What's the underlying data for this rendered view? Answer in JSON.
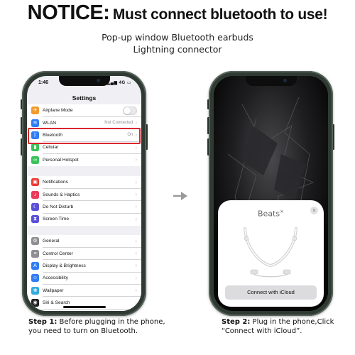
{
  "headline": {
    "notice": "NOTICE:",
    "rest": "Must connect bluetooth to use!"
  },
  "subtitle": {
    "line1": "Pop-up window Bluetooth earbuds",
    "line2": "Lightning connector"
  },
  "left_phone": {
    "time": "1:46",
    "network": "4G",
    "nav_title": "Settings",
    "groups": [
      [
        {
          "label": "Airplane Mode",
          "icon": "airplane-icon",
          "color": "#f29a2e",
          "control": "toggle"
        },
        {
          "label": "WLAN",
          "icon": "wifi-icon",
          "color": "#2f7cf6",
          "value": "Not Connected"
        },
        {
          "label": "Bluetooth",
          "icon": "bluetooth-icon",
          "color": "#2f7cf6",
          "value": "On"
        },
        {
          "label": "Cellular",
          "icon": "cellular-icon",
          "color": "#3ac25b"
        },
        {
          "label": "Personal Hotspot",
          "icon": "hotspot-icon",
          "color": "#3ac25b"
        }
      ],
      [
        {
          "label": "Notifications",
          "icon": "notifications-icon",
          "color": "#ec3b34"
        },
        {
          "label": "Sounds & Haptics",
          "icon": "sound-icon",
          "color": "#ec3b5a"
        },
        {
          "label": "Do Not Disturb",
          "icon": "moon-icon",
          "color": "#5a4fd6"
        },
        {
          "label": "Screen Time",
          "icon": "hourglass-icon",
          "color": "#5a4fd6"
        }
      ],
      [
        {
          "label": "General",
          "icon": "gear-icon",
          "color": "#8e8e93"
        },
        {
          "label": "Control Center",
          "icon": "control-center-icon",
          "color": "#8e8e93"
        },
        {
          "label": "Display & Brightness",
          "icon": "display-icon",
          "color": "#2f7cf6"
        },
        {
          "label": "Accessibility",
          "icon": "accessibility-icon",
          "color": "#2f7cf6"
        },
        {
          "label": "Wallpaper",
          "icon": "wallpaper-icon",
          "color": "#35aadc"
        },
        {
          "label": "Siri & Search",
          "icon": "siri-icon",
          "color": "#222222"
        },
        {
          "label": "Face ID & Passcode",
          "icon": "faceid-icon",
          "color": "#3ac25b"
        }
      ]
    ]
  },
  "right_phone": {
    "popup_title": "Beats",
    "close_symbol": "×",
    "button_label": "Connect with iCloud"
  },
  "steps": {
    "step1_label": "Step 1:",
    "step1_text": " Before plugging in the phone, you need to turn on Bluetooth.",
    "step2_label": "Step 2:",
    "step2_text": " Plug in the phone,Click “Connect with iCloud”."
  },
  "colors": {
    "highlight": "#d9282f",
    "frame": "#2f3a33",
    "ios_bg": "#efeff4"
  }
}
